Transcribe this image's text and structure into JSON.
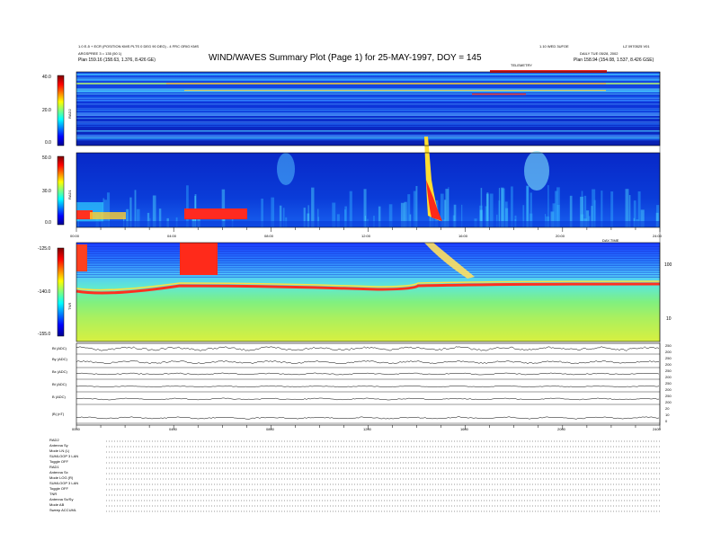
{
  "header": {
    "title": "WIND/WAVES Summary Plot (Page 1) for 25-MAY-1997, DOY = 145",
    "left_line1": "1.0 E-5 + ECR (POSITION KMS PLTS 0 DEG 90 DEG) - 4 FRC ORIG KMS",
    "left_line2": "ARGSPREE 3 = 135 (50 1)",
    "left_line3": "Plan     159.16 (158.63, 1.376, 8.426 GE)",
    "right_line1": "1.10 WED 3UFOE",
    "right_line2": "LZ 0970525 V01",
    "right_line3": "DAILY   TUE 05/28, 2002",
    "right_line4": "Plan   158.94 (154.08, 1.537, 8.426 GSE)",
    "top_bar_label": "TELEMETRY"
  },
  "chart_data": [
    {
      "type": "heatmap",
      "panel": "RAD2",
      "ylabel": "RAD2",
      "ylim": [
        0,
        40
      ],
      "yticks": [
        "40.0",
        "20.0",
        "0.0"
      ],
      "colorbar": "jet"
    },
    {
      "type": "heatmap",
      "panel": "RAD1",
      "ylabel": "RAD1",
      "ylim": [
        0,
        50
      ],
      "yticks": [
        "50.0",
        "30.0",
        "0.0"
      ],
      "colorbar": "jet",
      "xticks": [
        "00:00",
        "04:00",
        "08:00",
        "12:00",
        "16:00",
        "20:00",
        "24:00"
      ],
      "xlabel_right": "DAY-TIME"
    },
    {
      "type": "heatmap",
      "panel": "TNR",
      "ylabel": "TNR",
      "ylim": [
        -150,
        -125
      ],
      "yticks": [
        "-125.0",
        "-140.0",
        "-155.0"
      ],
      "right_ticks": [
        "100",
        "10"
      ],
      "colorbar": "jet"
    },
    {
      "type": "line",
      "panel": "magnetic field",
      "rows": [
        {
          "label": "Bt (ADC)",
          "ticks": [
            "250",
            "200"
          ]
        },
        {
          "label": "By (ADC)",
          "ticks": [
            "250",
            "200"
          ]
        },
        {
          "label": "Bx (ADC)",
          "ticks": [
            "250",
            "200"
          ]
        },
        {
          "label": "Bt (ADC)",
          "ticks": [
            "250",
            "200"
          ]
        },
        {
          "label": "B (ADC)",
          "ticks": [
            "250",
            "200"
          ]
        },
        {
          "label": "|B| (nT)",
          "ticks": [
            "20",
            "10",
            "0"
          ]
        }
      ],
      "xticks": [
        "0000",
        "0400",
        "0800",
        "1200",
        "1600",
        "2000",
        "2400"
      ]
    }
  ],
  "footer": {
    "labels": [
      "RAD2",
      "Antenna      Sy",
      "Mode       LN (L)",
      "SUMLOOP 3 LAN",
      "Toggle        OFF",
      "RAD1",
      "Antenna      Sx",
      "Mode   LOG (R)",
      "SUMLOOP 3 LAN",
      "Toggle        OFF",
      "TNR",
      "Antenna   Sx/Sy",
      "Mode           AB",
      "Sweep  ACCUML"
    ]
  }
}
